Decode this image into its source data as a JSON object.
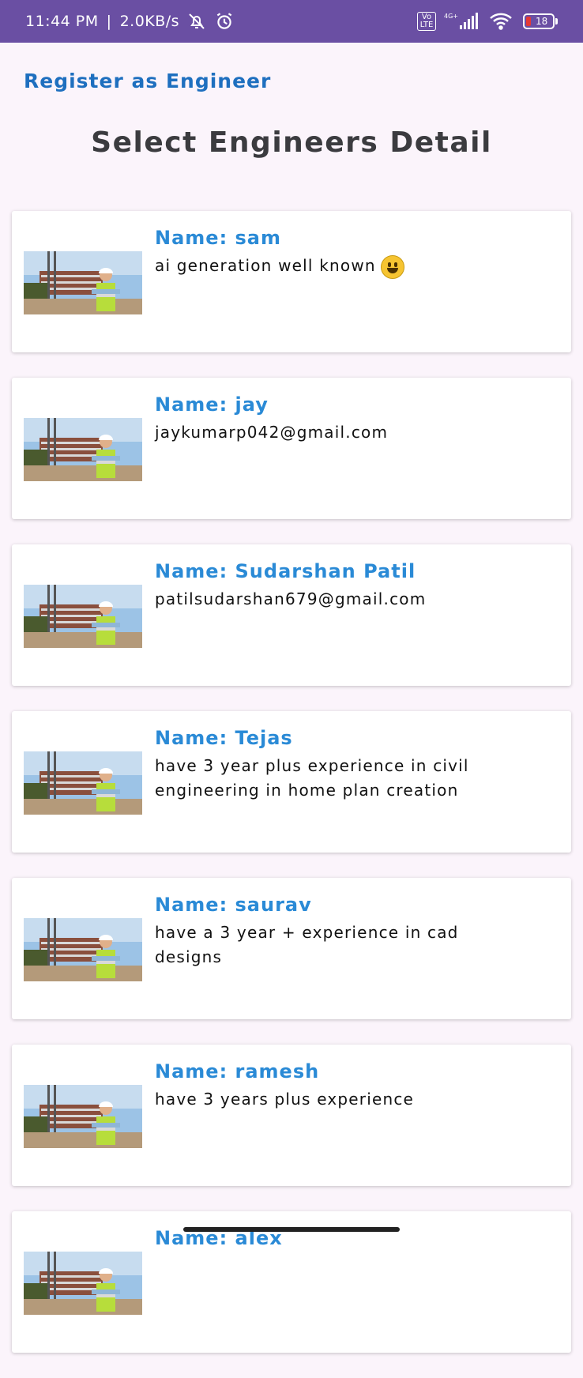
{
  "status_bar": {
    "time": "11:44 PM",
    "separator": "|",
    "net_speed": "2.0KB/s",
    "volte_label": "Vo LTE",
    "network": "4G+",
    "battery_level": "18"
  },
  "header": {
    "register_link": "Register as Engineer",
    "title": "Select Engineers Detail"
  },
  "engineers": [
    {
      "name": "Name: sam",
      "description": "ai generation well known"
    },
    {
      "name": "Name: jay",
      "description": "jaykumarp042@gmail.com"
    },
    {
      "name": "Name: Sudarshan Patil",
      "description": "patilsudarshan679@gmail.com"
    },
    {
      "name": "Name: Tejas",
      "description": "have 3 year plus experience in civil engineering in home plan creation"
    },
    {
      "name": "Name: saurav",
      "description": "have a 3 year + experience in cad designs"
    },
    {
      "name": "Name: ramesh",
      "description": "have 3 years plus experience"
    },
    {
      "name": "Name: alex",
      "description": ""
    }
  ],
  "colors": {
    "status_bar": "#6a4fa3",
    "background": "#fbf4fb",
    "link": "#1e6fbf",
    "name": "#2a8ad6",
    "title": "#3b3b3f",
    "battery_low": "#e53935"
  },
  "icons": [
    "mute-icon",
    "alarm-icon",
    "signal-icon",
    "wifi-icon",
    "battery-icon",
    "grinning-face-emoji"
  ]
}
